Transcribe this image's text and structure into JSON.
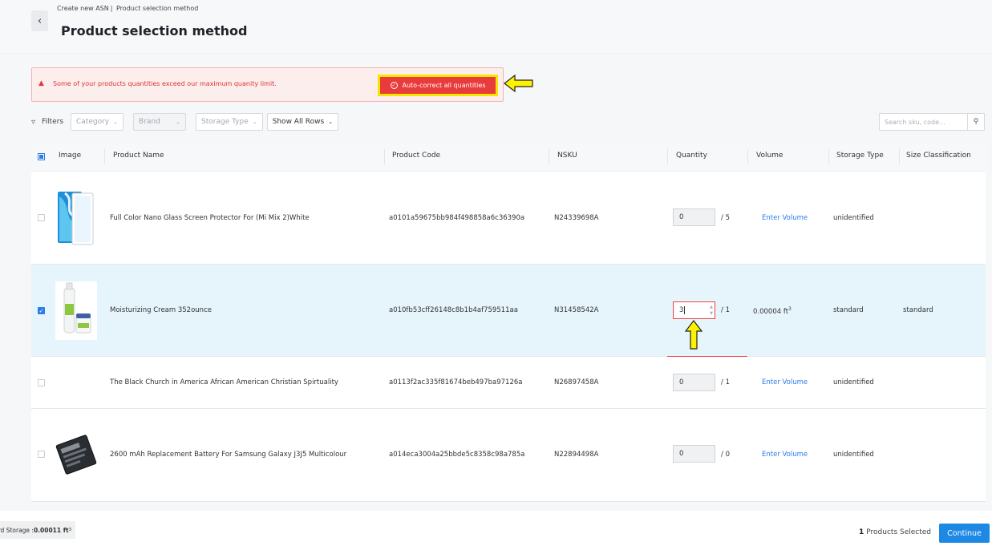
{
  "header": {
    "breadcrumb": [
      "Create new ASN",
      "Product selection method"
    ],
    "breadcrumb_sep": "|",
    "title": "Product selection method"
  },
  "alert": {
    "message": "Some of your products quantities exceed our maximum quanity limit.",
    "action_label": "Auto-correct all quantities"
  },
  "filters": {
    "label": "Filters",
    "dropdowns": [
      "Category",
      "Brand",
      "Storage Type",
      "Show All Rows"
    ],
    "search_placeholder": "Search sku, code..."
  },
  "table": {
    "columns": [
      "Image",
      "Product Name",
      "Product Code",
      "NSKU",
      "Quantity",
      "Volume",
      "Storage Type",
      "Size Classification"
    ],
    "rows": [
      {
        "selected": false,
        "name": "Full Color Nano Glass Screen Protector For (Mi Mix 2)White",
        "code": "a0101a59675bb984f498858a6c36390a",
        "nsku": "N24339698A",
        "quantity": "0",
        "limit": "/ 5",
        "volume": "Enter Volume",
        "storage_type": "unidentified",
        "size_class": ""
      },
      {
        "selected": true,
        "name": "Moisturizing Cream 352ounce",
        "code": "a010fb53cff26148c8b1b4af759511aa",
        "nsku": "N31458542A",
        "quantity": "3",
        "limit": "/ 1",
        "volume": "0.00004 ft",
        "storage_type": "standard",
        "size_class": "standard"
      },
      {
        "selected": false,
        "name": "The Black Church in America African American Christian Spirtuality",
        "code": "a0113f2ac335f81674beb497ba97126a",
        "nsku": "N26897458A",
        "quantity": "0",
        "limit": "/ 1",
        "volume": "Enter Volume",
        "storage_type": "unidentified",
        "size_class": ""
      },
      {
        "selected": false,
        "name": "2600 mAh Replacement Battery For Samsung Galaxy J3J5 Multicolour",
        "code": "a014eca3004a25bbde5c8358c98a785a",
        "nsku": "N22894498A",
        "quantity": "0",
        "limit": "/ 0",
        "volume": "Enter Volume",
        "storage_type": "unidentified",
        "size_class": ""
      }
    ]
  },
  "footer": {
    "storage_label": "ard Storage :",
    "storage_value": "0.00011 ft",
    "selected_count": "1",
    "selected_label": "Products Selected",
    "continue_label": "Continue"
  },
  "icons": {
    "back": "chevron-left-icon",
    "alert": "warning-triangle-icon",
    "filter": "funnel-icon",
    "search": "search-icon"
  },
  "colors": {
    "accent": "#1e88e5",
    "error": "#e93b3b",
    "highlight": "#f5e600",
    "selected_row": "#e6f4fb"
  }
}
